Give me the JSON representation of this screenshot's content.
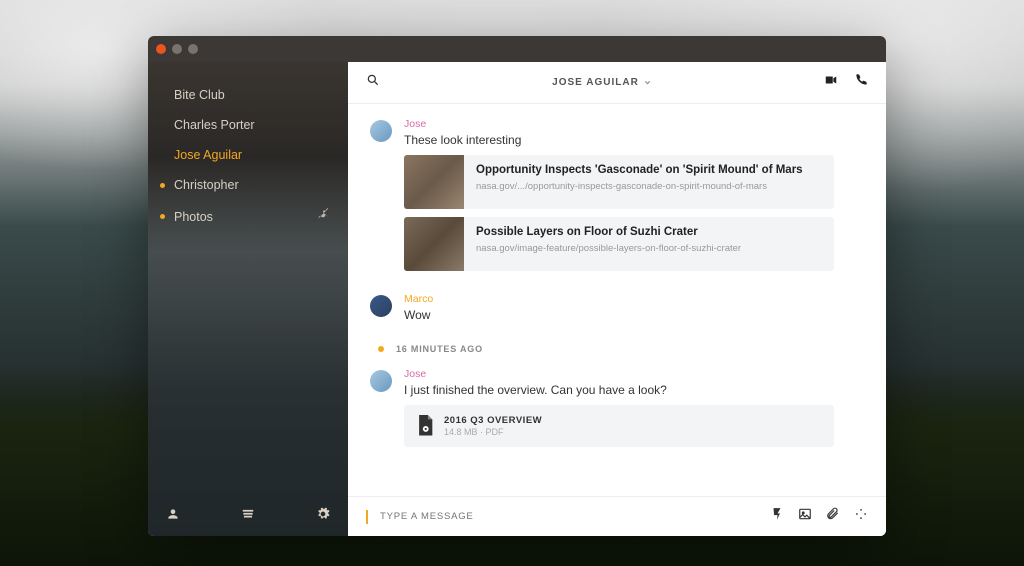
{
  "colors": {
    "accent": "#f5a623",
    "close": "#e95420"
  },
  "sidebar": {
    "contacts": [
      {
        "label": "Bite Club",
        "active": false,
        "dot": false
      },
      {
        "label": "Charles Porter",
        "active": false,
        "dot": false
      },
      {
        "label": "Jose Aguilar",
        "active": true,
        "dot": false
      },
      {
        "label": "Christopher",
        "active": false,
        "dot": true
      },
      {
        "label": "Photos",
        "active": false,
        "dot": true,
        "muted": true
      }
    ]
  },
  "header": {
    "title": "JOSE AGUILAR"
  },
  "messages": [
    {
      "sender": "Jose",
      "senderClass": "pink",
      "avatar": "linear-gradient(135deg,#a8c8e0,#6898c0)",
      "text": "These look interesting",
      "links": [
        {
          "title": "Opportunity Inspects 'Gasconade' on 'Spirit Mound' of Mars",
          "url": "nasa.gov/.../opportunity-inspects-gasconade-on-spirit-mound-of-mars"
        },
        {
          "title": "Possible Layers on Floor of Suzhi Crater",
          "url": "nasa.gov/image-feature/possible-layers-on-floor-of-suzhi-crater"
        }
      ]
    },
    {
      "sender": "Marco",
      "senderClass": "orange",
      "avatar": "linear-gradient(135deg,#3a5a8a,#2a4060)",
      "text": "Wow"
    },
    {
      "timeSeparator": "16 MINUTES AGO"
    },
    {
      "sender": "Jose",
      "senderClass": "pink",
      "avatar": "linear-gradient(135deg,#a8c8e0,#6898c0)",
      "text": "I just finished the overview. Can you have a look?",
      "file": {
        "name": "2016 Q3 OVERVIEW",
        "size": "14.8 MB",
        "type": "PDF"
      }
    }
  ],
  "composer": {
    "placeholder": "TYPE A MESSAGE"
  }
}
